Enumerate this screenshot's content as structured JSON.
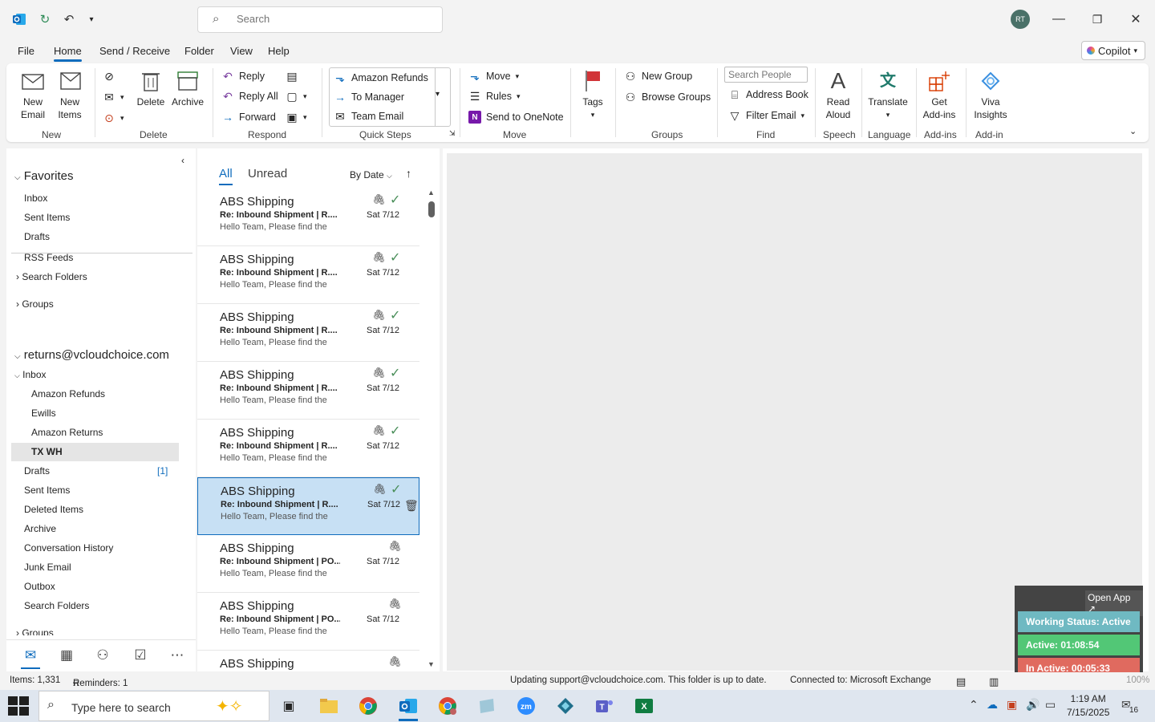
{
  "titlebar": {
    "search_placeholder": "Search",
    "avatar_initials": "RT"
  },
  "menu": [
    "File",
    "Home",
    "Send / Receive",
    "Folder",
    "View",
    "Help"
  ],
  "copilot_label": "Copilot",
  "ribbon": {
    "new_email": "New\nEmail",
    "new_items": "New\nItems",
    "delete": "Delete",
    "archive": "Archive",
    "reply": "Reply",
    "reply_all": "Reply All",
    "forward": "Forward",
    "qs_amazon_refunds": "Amazon Refunds",
    "qs_to_manager": "To Manager",
    "qs_team_email": "Team Email",
    "move": "Move",
    "rules": "Rules",
    "send_onenote": "Send to OneNote",
    "tags": "Tags",
    "new_group": "New Group",
    "browse_groups": "Browse Groups",
    "search_people": "Search People",
    "address_book": "Address Book",
    "filter_email": "Filter Email",
    "read_aloud": "Read\nAloud",
    "translate": "Translate",
    "get_addins": "Get\nAdd-ins",
    "viva_insights": "Viva\nInsights",
    "groups": {
      "new": "New",
      "delete": "Delete",
      "respond": "Respond",
      "quick_steps": "Quick Steps",
      "move": "Move",
      "groups": "Groups",
      "find": "Find",
      "speech": "Speech",
      "language": "Language",
      "addins": "Add-ins",
      "addin": "Add-in"
    }
  },
  "folders": {
    "favorites": "Favorites",
    "fav_inbox": "Inbox",
    "fav_sent": "Sent Items",
    "fav_drafts": "Drafts",
    "rss": "RSS Feeds",
    "search_folders_1": "Search Folders",
    "groups_1": "Groups",
    "account": "returns@vcloudchoice.com",
    "inbox": "Inbox",
    "amazon_refunds": "Amazon Refunds",
    "ewills": "Ewills",
    "amazon_returns": "Amazon Returns",
    "tx_wh": "TX WH",
    "drafts": "Drafts",
    "drafts_count": "[1]",
    "sent_items": "Sent Items",
    "deleted_items": "Deleted Items",
    "archive": "Archive",
    "conversation_history": "Conversation History",
    "junk_email": "Junk Email",
    "outbox": "Outbox",
    "search_folders_2": "Search Folders",
    "groups_2": "Groups"
  },
  "list": {
    "tab_all": "All",
    "tab_unread": "Unread",
    "sort": "By Date",
    "messages": [
      {
        "sender": "ABS Shipping",
        "subject": "Re: Inbound Shipment | R....",
        "preview": "Hello Team,  Please find the",
        "date": "Sat 7/12",
        "replied": true
      },
      {
        "sender": "ABS Shipping",
        "subject": "Re: Inbound Shipment | R....",
        "preview": "Hello Team,  Please find the",
        "date": "Sat 7/12",
        "replied": true
      },
      {
        "sender": "ABS Shipping",
        "subject": "Re: Inbound Shipment | R....",
        "preview": "Hello Team,  Please find the",
        "date": "Sat 7/12",
        "replied": true
      },
      {
        "sender": "ABS Shipping",
        "subject": "Re: Inbound Shipment | R....",
        "preview": "Hello Team,  Please find the",
        "date": "Sat 7/12",
        "replied": true
      },
      {
        "sender": "ABS Shipping",
        "subject": "Re: Inbound Shipment | R....",
        "preview": "Hello Team,  Please find the",
        "date": "Sat 7/12",
        "replied": true
      },
      {
        "sender": "ABS Shipping",
        "subject": "Re: Inbound Shipment | R....",
        "preview": "Hello Team,  Please find the",
        "date": "Sat 7/12",
        "replied": true
      },
      {
        "sender": "ABS Shipping",
        "subject": "Re: Inbound Shipment | PO...",
        "preview": "Hello Team,  Please find the",
        "date": "Sat 7/12",
        "replied": false
      },
      {
        "sender": "ABS Shipping",
        "subject": "Re: Inbound Shipment | PO...",
        "preview": "Hello Team,  Please find the",
        "date": "Sat 7/12",
        "replied": false
      },
      {
        "sender": "ABS Shipping",
        "subject": "",
        "preview": "",
        "date": "",
        "replied": false
      }
    ]
  },
  "widget": {
    "open_app": "Open App ↗",
    "working_status": "Working Status: Active",
    "active": "Active: 01:08:54",
    "inactive": "In Active: 00:05:33",
    "colors": {
      "status": "#6fb9c2",
      "active": "#52c776",
      "inactive": "#e06a5f"
    }
  },
  "status": {
    "items": "Items: 1,331",
    "reminders": "Reminders: 1",
    "updating": "Updating support@vcloudchoice.com.  This folder is up to date.",
    "connected": "Connected to: Microsoft Exchange",
    "zoom": "100%"
  },
  "taskbar": {
    "search_placeholder": "Type here to search",
    "time": "1:19 AM",
    "date": "7/15/2025",
    "notif_count": "16"
  },
  "accent": "#0f6cbd"
}
